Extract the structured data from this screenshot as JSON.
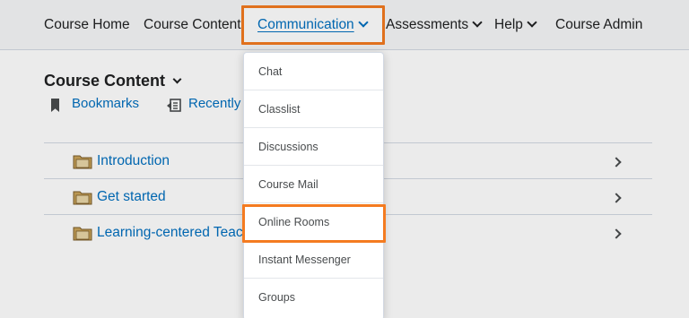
{
  "navbar": {
    "items": [
      {
        "label": "Course Home"
      },
      {
        "label": "Course Content"
      },
      {
        "label": "Communication"
      },
      {
        "label": "Assessments"
      },
      {
        "label": "Help"
      },
      {
        "label": "Course Admin"
      }
    ]
  },
  "content": {
    "title": "Course Content",
    "subnav": {
      "bookmarks": "Bookmarks",
      "recently": "Recently"
    },
    "rows": [
      {
        "label": "Introduction"
      },
      {
        "label": "Get started"
      },
      {
        "label": "Learning-centered Teac"
      }
    ]
  },
  "dropdown": {
    "items": [
      {
        "label": "Chat"
      },
      {
        "label": "Classlist"
      },
      {
        "label": "Discussions"
      },
      {
        "label": "Course Mail"
      },
      {
        "label": "Online Rooms"
      },
      {
        "label": "Instant Messenger"
      },
      {
        "label": "Groups"
      }
    ]
  },
  "colors": {
    "accent": "#006fbf",
    "highlight": "#f47b20"
  },
  "icons": [
    "bookmark-icon",
    "recent-icon",
    "folder-icon",
    "chevron-down-icon",
    "chevron-right-icon"
  ]
}
